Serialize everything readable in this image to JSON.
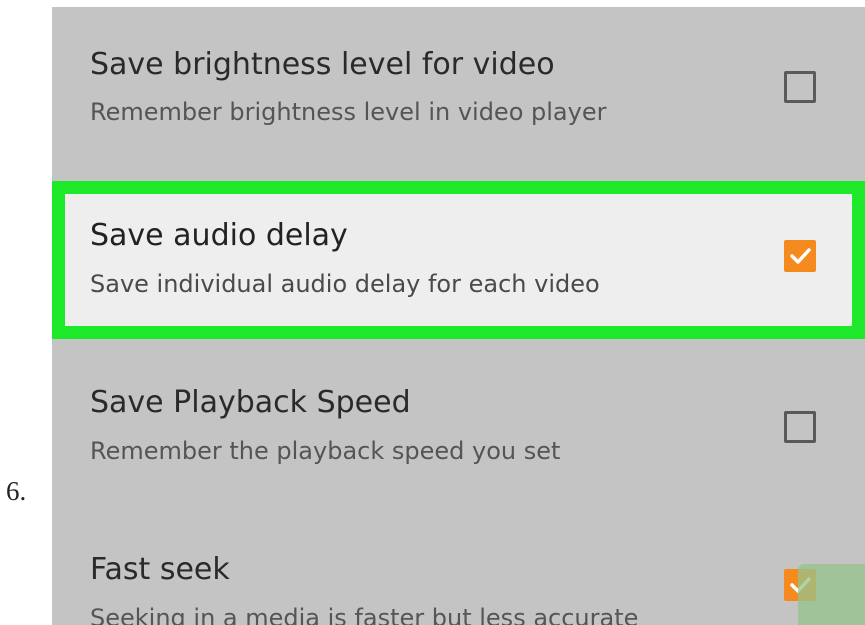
{
  "step_number": "6.",
  "settings": [
    {
      "title": "Save brightness level for video",
      "description": "Remember brightness level in video player",
      "checked": false
    },
    {
      "title": "Save audio delay",
      "description": "Save individual audio delay for each video",
      "checked": true,
      "highlighted": true
    },
    {
      "title": "Save Playback Speed",
      "description": "Remember the playback speed you set",
      "checked": false
    },
    {
      "title": "Fast seek",
      "description": "Seeking in a media is faster but less accurate",
      "checked": true
    }
  ],
  "colors": {
    "panel_background": "#c4c4c4",
    "highlight_border": "#1ee82a",
    "highlight_background": "#eeeeee",
    "checkbox_checked": "#f58a1f"
  },
  "icons": {
    "checkbox_checked": "checkmark-icon",
    "checkbox_unchecked": "empty-checkbox-icon"
  }
}
